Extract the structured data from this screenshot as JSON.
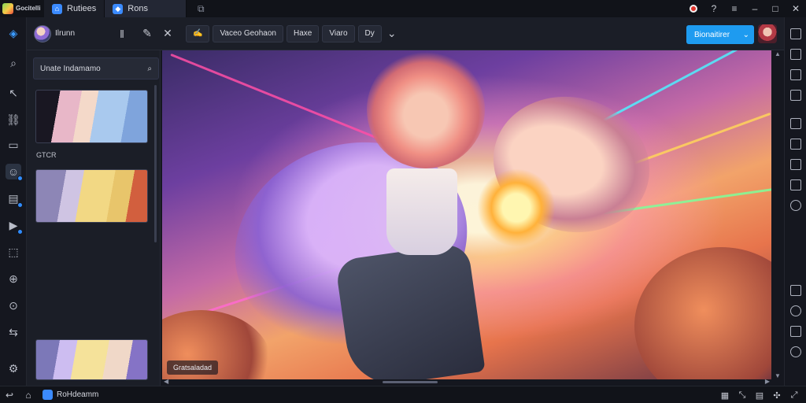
{
  "titlebar": {
    "app_name": "Gocitelli",
    "tabs": [
      {
        "label": "Rutiees",
        "icon": "home-icon"
      },
      {
        "label": "Rons",
        "icon": "app-icon"
      }
    ],
    "new_tab_icon": "new-tab-icon"
  },
  "toolbar": {
    "user_name": "Ilrunn",
    "buttons": [
      {
        "label": "Vaceo Geohaon"
      },
      {
        "label": "Haxe"
      },
      {
        "label": "Viaro"
      },
      {
        "label": "Dy"
      }
    ],
    "primary_label": "Bionaitirer",
    "accent": "#1e9bf0"
  },
  "sidepanel": {
    "search_placeholder": "Unate Indamamo",
    "section_label": "GTCR"
  },
  "gameview": {
    "watermark": "Gratsaladad"
  },
  "bottombar": {
    "app_label": "RoHdeamm"
  }
}
